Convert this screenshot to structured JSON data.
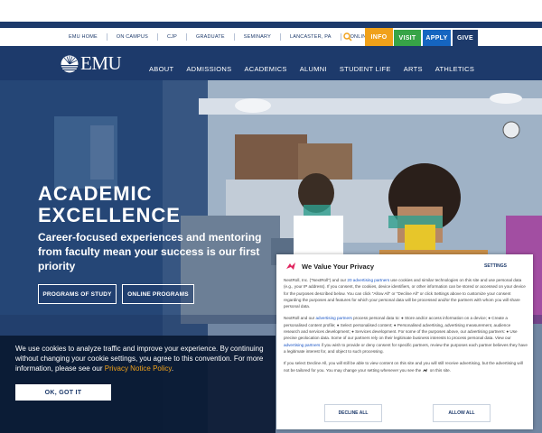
{
  "utility": {
    "links": [
      "EMU HOME",
      "ON CAMPUS",
      "CJP",
      "GRADUATE",
      "SEMINARY",
      "LANCASTER, PA",
      "ONLINE"
    ],
    "search_icon": "search-icon",
    "buttons": {
      "info": "INFO",
      "visit": "VISIT",
      "apply": "APPLY",
      "give": "GIVE"
    }
  },
  "colors": {
    "navy": "#1d3a6b",
    "info": "#f0a11a",
    "visit": "#37a447",
    "apply": "#1565c0",
    "give": "#1d3a6b"
  },
  "nav": {
    "logo_text": "EMU",
    "items": [
      "ABOUT",
      "ADMISSIONS",
      "ACADEMICS",
      "ALUMNI",
      "STUDENT LIFE",
      "ARTS",
      "ATHLETICS"
    ]
  },
  "hero": {
    "title_line1": "ACADEMIC",
    "title_line2": "EXCELLENCE",
    "subtitle": "Career-focused experiences and mentoring from faculty mean your success is our first priority",
    "btn_programs": "PROGRAMS OF STUDY",
    "btn_online": "ONLINE PROGRAMS"
  },
  "cookie": {
    "text": "We use cookies to analyze traffic and improve your experience. By continuing without changing your cookie settings, you agree to this convention. For more information, please see our ",
    "link": "Privacy Notice Policy",
    "text_end": ".",
    "ok": "OK, GOT IT"
  },
  "consent": {
    "title": "We Value Your Privacy",
    "settings": "SETTINGS",
    "p1_a": "NextRoll, Inc. (\"NextRoll\") and our ",
    "p1_link": "20 advertising partners",
    "p1_b": " use cookies and similar technologies on this site and use personal data (e.g., your IP address). If you consent, the cookies, device identifiers, or other information can be stored or accessed on your device for the purposes described below. You can click \"Allow All\" or \"Decline All\" or click Settings above to customize your consent regarding the purposes and features for which your personal data will be processed and/or the partners with whom you will share personal data.",
    "p2_a": "NextRoll and our ",
    "p2_link": "advertising partners",
    "p2_b": " process personal data to: ● Store and/or access information on a device; ● Create a personalised content profile; ● Select personalised content; ● Personalised advertising, advertising measurement, audience research and services development; ● Services development. For some of the purposes above, our advertising partners: ● Use precise geolocation data. Some of our partners rely on their legitimate business interests to process personal data. View our ",
    "p2_link2": "advertising partners",
    "p2_c": " if you wish to provide or deny consent for specific partners, review the purposes each partner believes they have a legitimate interest for, and object to such processing.",
    "p3_a": "If you select Decline All, you will still be able to view content on this site and you will still receive advertising, but the advertising will not be tailored for you. You may change your setting whenever you see the ",
    "p3_b": " on this site.",
    "decline": "DECLINE ALL",
    "allow": "ALLOW ALL"
  }
}
